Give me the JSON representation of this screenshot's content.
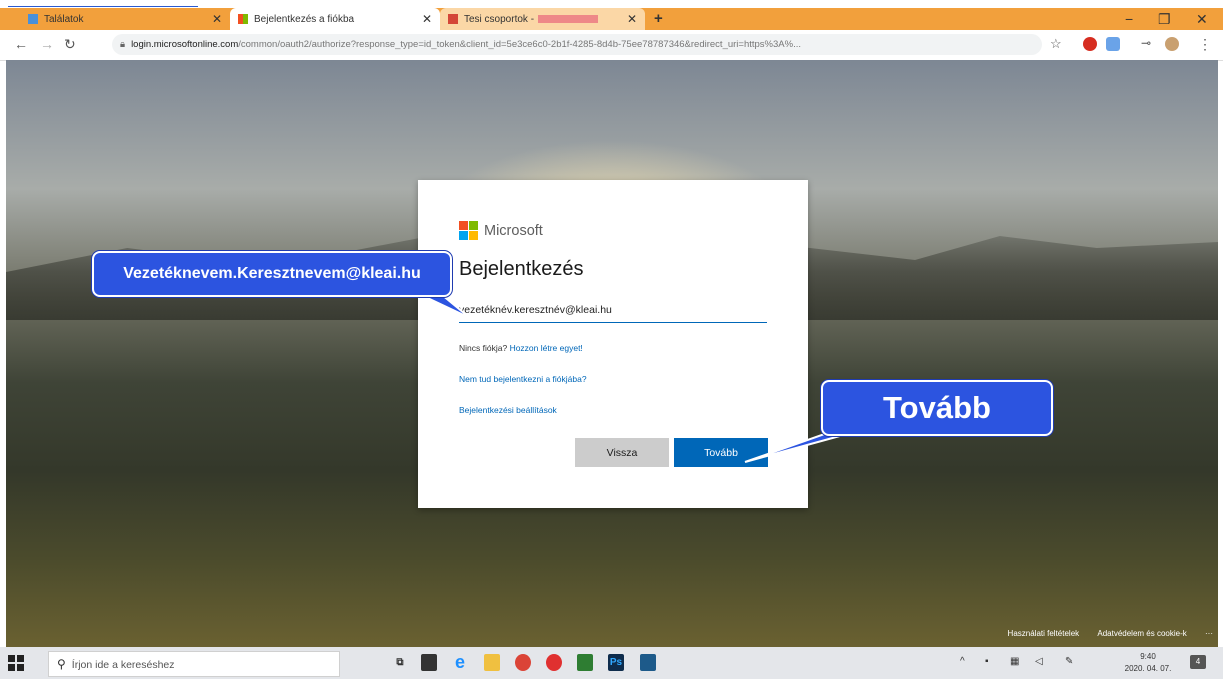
{
  "browser": {
    "tabs": [
      {
        "title": "Találatok",
        "active": false
      },
      {
        "title": "Bejelentkezés a fiókba",
        "active": true
      },
      {
        "title": "Tesi csoportok - ",
        "active": false
      }
    ],
    "new_tab": "+",
    "window_controls": {
      "minimize": "−",
      "maximize": "❐",
      "close": "✕"
    },
    "url_host": "login.microsoftonline.com",
    "url_path": "/common/oauth2/authorize?response_type=id_token&client_id=5e3ce6c0-2b1f-4285-8d4b-75ee78787346&redirect_uri=https%3A%..."
  },
  "signin": {
    "brand": "Microsoft",
    "title": "Bejelentkezés",
    "email_value": "vezetéknév.keresztnév@kleai.hu",
    "no_account_text": "Nincs fiókja?",
    "create_link": "Hozzon létre egyet!",
    "cant_access_link": "Nem tud bejelentkezni a fiókjába?",
    "options_link": "Bejelentkezési beállítások",
    "back_button": "Vissza",
    "next_button": "Tovább"
  },
  "callouts": {
    "email_hint": "Vezetéknevem.Keresztnevem@kleai.hu",
    "next_hint": "Tovább"
  },
  "footer": {
    "terms": "Használati feltételek",
    "privacy": "Adatvédelem és cookie-k",
    "more": "···"
  },
  "taskbar": {
    "search_placeholder": "Írjon ide a kereséshez",
    "time": "9:40",
    "date": "2020. 04. 07."
  },
  "colors": {
    "tab_bar": "#f2a03c",
    "ms_blue": "#0067b8",
    "callout_blue": "#2c54e0",
    "ms_red": "#f25022",
    "ms_green": "#7fba00",
    "ms_blue_sq": "#00a4ef",
    "ms_yellow": "#ffb900"
  }
}
